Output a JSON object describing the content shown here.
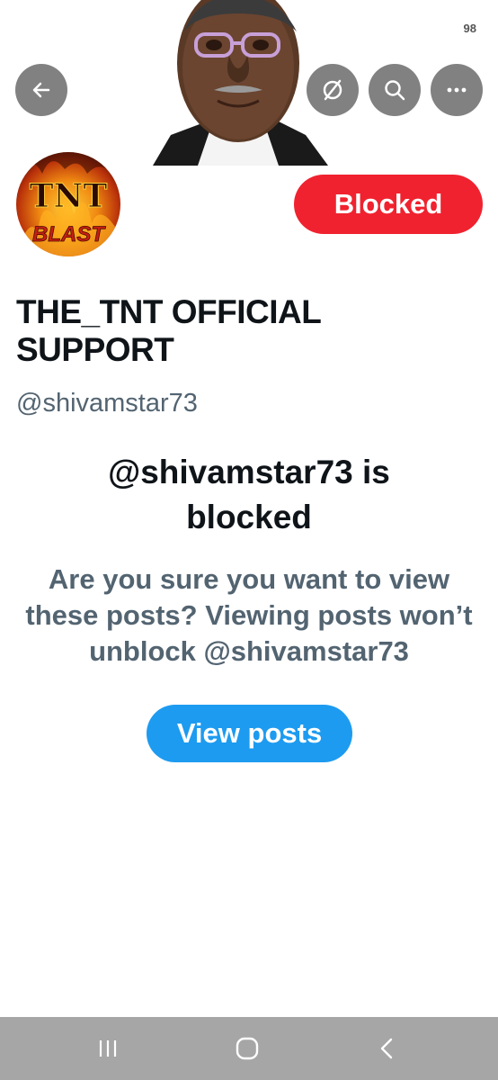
{
  "status_bar": {
    "battery": "98"
  },
  "header": {
    "back_icon": "arrow-left-icon",
    "grok_icon": "slash-circle-icon",
    "search_icon": "search-icon",
    "more_icon": "more-horizontal-icon"
  },
  "avatar": {
    "text_top": "TNT",
    "text_bottom": "BLAST"
  },
  "profile": {
    "blocked_label": "Blocked",
    "display_name": "THE_TNT OFFICIAL SUPPORT",
    "handle": "@shivamstar73"
  },
  "blocked_notice": {
    "heading_line1": "@shivamstar73 is",
    "heading_line2": "blocked",
    "description": "Are you sure you want to view these posts? Viewing posts won’t unblock @shivamstar73",
    "view_posts_label": "View posts"
  },
  "nav": {
    "recents_icon": "recents-icon",
    "home_icon": "home-icon",
    "back_icon": "chevron-left-icon"
  },
  "colors": {
    "blocked_red": "#f0222f",
    "accent_blue": "#1d9bf0",
    "text_primary": "#0f1419",
    "text_secondary": "#536471"
  }
}
